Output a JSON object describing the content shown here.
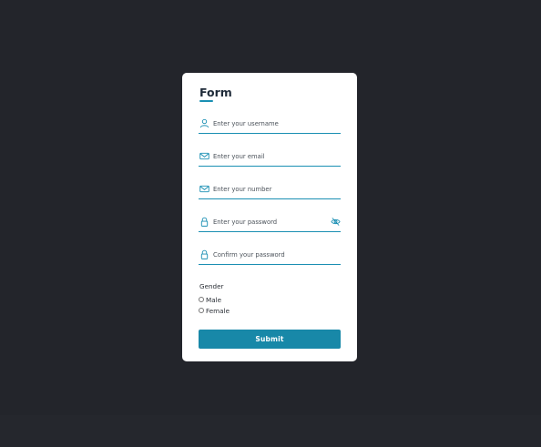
{
  "form": {
    "title": "Form",
    "fields": {
      "username": {
        "placeholder": "Enter your username",
        "value": "",
        "icon": "user-icon"
      },
      "email": {
        "placeholder": "Enter your email",
        "value": "",
        "icon": "envelope-icon"
      },
      "number": {
        "placeholder": "Enter your number",
        "value": "",
        "icon": "envelope-icon"
      },
      "password": {
        "placeholder": "Enter your password",
        "value": "",
        "icon": "lock-icon",
        "toggle_icon": "eye-slash-icon"
      },
      "confirm": {
        "placeholder": "Confirm your password",
        "value": "",
        "icon": "lock-icon"
      }
    },
    "gender": {
      "label": "Gender",
      "options": [
        "Male",
        "Female"
      ]
    },
    "submit_label": "Submit"
  },
  "colors": {
    "background": "#23252b",
    "card": "#ffffff",
    "accent": "#1a8fb3",
    "button": "#1888a8"
  }
}
